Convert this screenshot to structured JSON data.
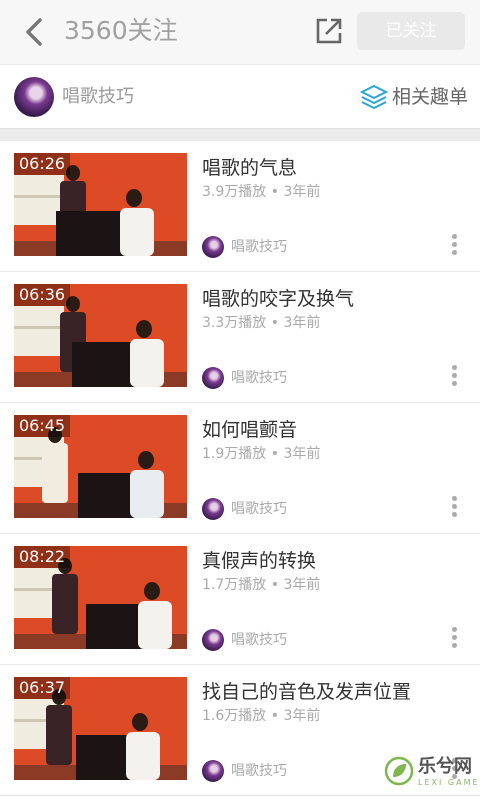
{
  "header": {
    "follow_count_text": "3560关注",
    "followed_label": "已关注"
  },
  "channel": {
    "name": "唱歌技巧",
    "related_label": "相关趣单"
  },
  "videos": [
    {
      "duration": "06:26",
      "title": "唱歌的气息",
      "views": "3.9万播放",
      "age": "3年前",
      "uploader": "唱歌技巧"
    },
    {
      "duration": "06:36",
      "title": "唱歌的咬字及换气",
      "views": "3.3万播放",
      "age": "3年前",
      "uploader": "唱歌技巧"
    },
    {
      "duration": "06:45",
      "title": "如何唱颤音",
      "views": "1.9万播放",
      "age": "3年前",
      "uploader": "唱歌技巧"
    },
    {
      "duration": "08:22",
      "title": "真假声的转换",
      "views": "1.7万播放",
      "age": "3年前",
      "uploader": "唱歌技巧"
    },
    {
      "duration": "06:37",
      "title": "找自己的音色及发声位置",
      "views": "1.6万播放",
      "age": "3年前",
      "uploader": "唱歌技巧"
    }
  ],
  "watermark": {
    "text": "乐兮网",
    "sub": "LEXI GAME"
  },
  "colors": {
    "accent": "#2aa6d8",
    "tab_bg": "#f7f7f7",
    "thumb_bg": "#dd4a26"
  }
}
